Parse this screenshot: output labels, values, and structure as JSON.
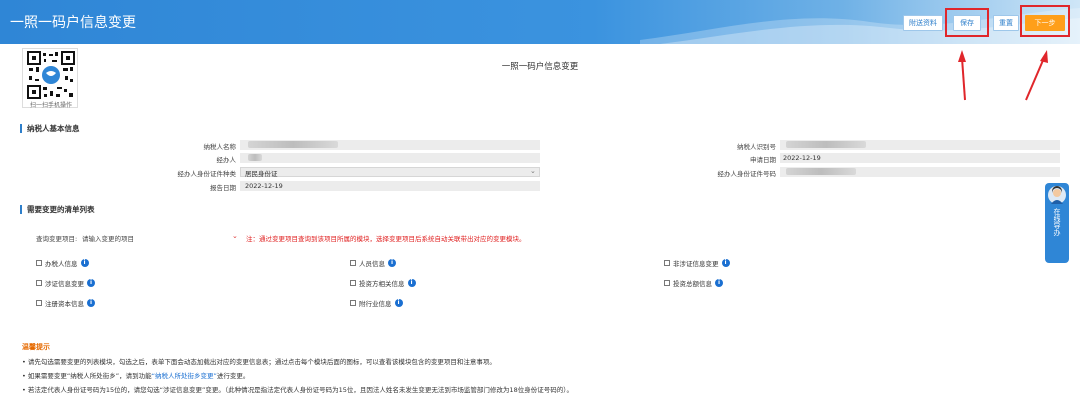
{
  "app": {
    "title": "一照一码户信息变更"
  },
  "toolbar": {
    "attach_label": "附送资料",
    "save_label": "保存",
    "reset_label": "重置",
    "next_label": "下一步"
  },
  "qr": {
    "caption": "扫一扫手机操作"
  },
  "form": {
    "title": "一照一码户信息变更"
  },
  "basic_info": {
    "heading": "纳税人基本信息",
    "taxpayer_name_label": "纳税人名称",
    "taxpayer_id_label": "纳税人识别号",
    "agent_label": "经办人",
    "apply_date_label": "申请日期",
    "apply_date_value": "2022-12-19",
    "agent_id_type_label": "经办人身份证件种类",
    "agent_id_type_value": "居民身份证",
    "agent_id_number_label": "经办人身份证件号码",
    "report_date_label": "报告日期",
    "report_date_value": "2022-12-19"
  },
  "change_list": {
    "heading": "需要变更的清单列表",
    "query_label": "查询变更项目:",
    "query_placeholder": "请输入变更的项目",
    "note": "注：通过变更项目查询到该项目所属的模块，选择变更项目后系统自动关联带出对应的变更模块。",
    "items": [
      {
        "label": "办税人信息"
      },
      {
        "label": "人员信息"
      },
      {
        "label": "非涉证信息变更"
      },
      {
        "label": "涉证信息变更"
      },
      {
        "label": "投资方相关信息"
      },
      {
        "label": "投资总额信息"
      },
      {
        "label": "注册资本信息"
      },
      {
        "label": "附行业信息"
      }
    ],
    "info_glyph": "i"
  },
  "tips": {
    "title": "温馨提示",
    "line1": "• 请先勾选需要变更的列表模块，勾选之后，表单下面会动态加载出对应的变更信息表；通过点击每个模块后面的图标，可以查看该模块包含的变更项目和注意事项。",
    "line2_pre": "• 如果需要变更“纳税人所处街乡”，请到功能",
    "line2_link": "“纳税人所处街乡变更”",
    "line2_post": "进行变更。",
    "line3": "• 若法定代表人身份证号码为15位的，请您勾选“涉证信息变更”变更。（此种情况是指法定代表人身份证号码为15位，且因法人姓名未发生变更无法到市场监管部门修改为18位身份证号码的）。"
  },
  "guide": {
    "label": "在线导办"
  },
  "colors": {
    "header": "#2f86d6",
    "accent": "#ff9f1a",
    "highlight": "#e0262b",
    "note": "#e02020",
    "link": "#1a6fd1"
  },
  "icons": {
    "dropdown": "chevron-down-icon",
    "info": "info-icon",
    "qr": "qr-code-icon",
    "avatar": "avatar-icon"
  }
}
